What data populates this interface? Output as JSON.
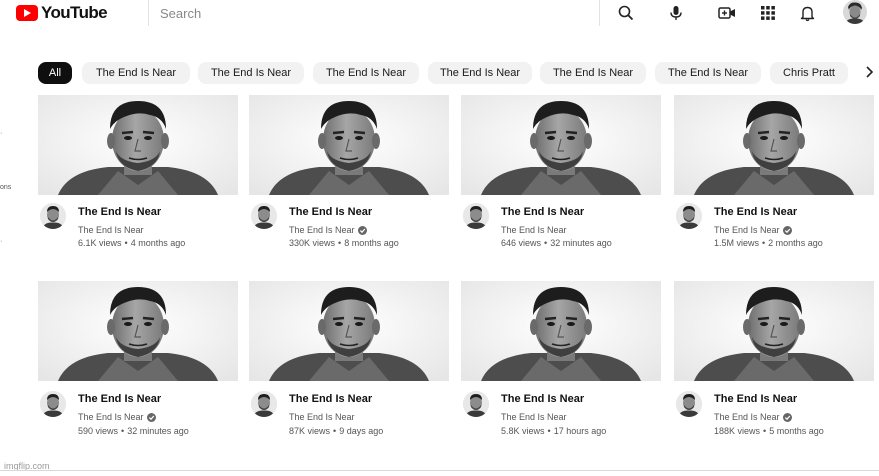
{
  "brand": {
    "name": "YouTube",
    "color": "#ff0000"
  },
  "search": {
    "placeholder": "Search"
  },
  "header_icons": [
    "search-icon",
    "microphone-icon",
    "create-video-icon",
    "apps-grid-icon",
    "notifications-bell-icon",
    "account-avatar"
  ],
  "chips": [
    {
      "label": "All",
      "active": true
    },
    {
      "label": "The End Is Near",
      "active": false
    },
    {
      "label": "The End Is Near",
      "active": false
    },
    {
      "label": "The End Is Near",
      "active": false
    },
    {
      "label": "The End Is Near",
      "active": false
    },
    {
      "label": "The End Is Near",
      "active": false
    },
    {
      "label": "The End Is Near",
      "active": false
    },
    {
      "label": "Chris Pratt",
      "active": false
    }
  ],
  "sidebar_fragment": {
    "label": "ons"
  },
  "videos": [
    {
      "title": "The End Is Near",
      "channel": "The End Is Near",
      "verified": false,
      "views": "6.1K views",
      "age": "4 months ago"
    },
    {
      "title": "The End Is Near",
      "channel": "The End Is Near",
      "verified": true,
      "views": "330K views",
      "age": "8 months ago"
    },
    {
      "title": "The End Is Near",
      "channel": "The End Is Near",
      "verified": false,
      "views": "646 views",
      "age": "32 minutes ago"
    },
    {
      "title": "The End Is Near",
      "channel": "The End Is Near",
      "verified": true,
      "views": "1.5M views",
      "age": "2 months ago"
    },
    {
      "title": "The End Is Near",
      "channel": "The End Is Near",
      "verified": true,
      "views": "590 views",
      "age": "32 minutes ago"
    },
    {
      "title": "The End Is Near",
      "channel": "The End Is Near",
      "verified": false,
      "views": "87K views",
      "age": "9 days ago"
    },
    {
      "title": "The End Is Near",
      "channel": "The End Is Near",
      "verified": false,
      "views": "5.8K views",
      "age": "17 hours ago"
    },
    {
      "title": "The End Is Near",
      "channel": "The End Is Near",
      "verified": true,
      "views": "188K views",
      "age": "5 months ago"
    }
  ],
  "meta_separator": "•",
  "watermark": "imgflip.com"
}
